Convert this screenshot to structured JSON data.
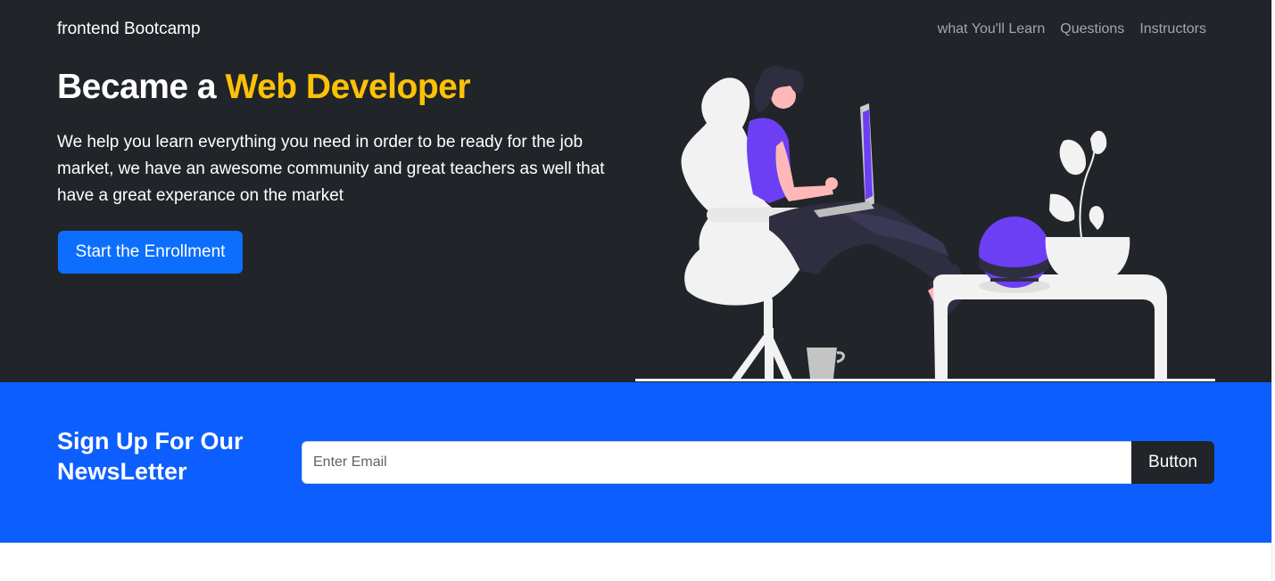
{
  "header": {
    "brand": "frontend Bootcamp",
    "nav": [
      "what You'll Learn",
      "Questions",
      "Instructors"
    ]
  },
  "hero": {
    "title_prefix": "Became a ",
    "title_highlight": "Web Developer",
    "description": "We help you learn everything you need in order to be ready for the job market, we have an awesome community and great teachers as well that have a great experance on the market",
    "cta_label": "Start the Enrollment"
  },
  "newsletter": {
    "title": "Sign Up For Our NewsLetter",
    "input_placeholder": "Enter Email",
    "input_value": "",
    "button_label": "Button"
  },
  "colors": {
    "hero_bg": "#212529",
    "accent_yellow": "#ffc107",
    "primary_blue": "#0d6efd",
    "newsletter_bg": "#0d5efe",
    "illustration_purple": "#6c3ff5",
    "illustration_light": "#f2f2f2"
  },
  "icons": [
    "woman-on-chair-with-laptop-illustration"
  ]
}
